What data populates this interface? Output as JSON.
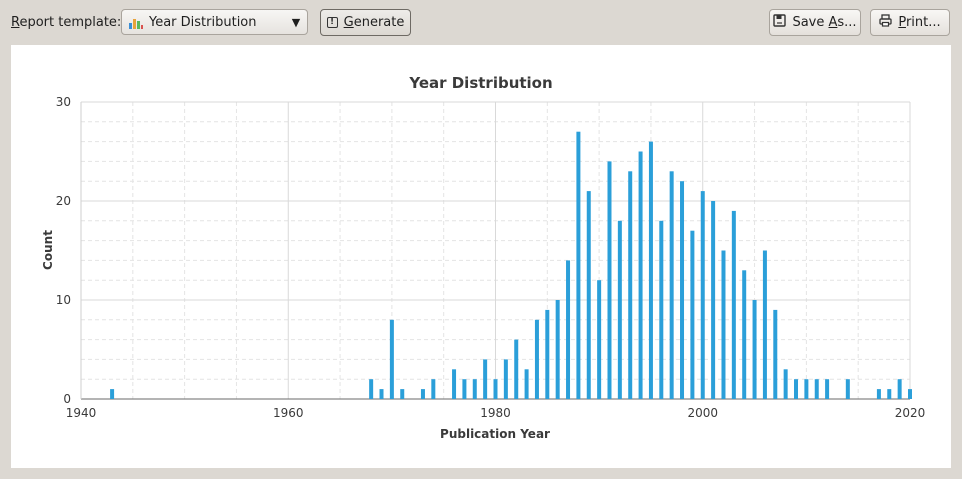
{
  "toolbar": {
    "template_label_mnemonic": "R",
    "template_label_rest": "eport template:",
    "template_value": "Year Distribution",
    "template_icon": "bar-chart-icon",
    "generate_mnemonic": "G",
    "generate_rest": "enerate",
    "generate_icon": "generate-icon",
    "save_pre": "Save ",
    "save_mnemonic": "A",
    "save_post": "s...",
    "save_icon": "save-icon",
    "print_pre": "",
    "print_mnemonic": "P",
    "print_post": "rint...",
    "print_icon": "printer-icon"
  },
  "chart_data": {
    "type": "bar",
    "title": "Year Distribution",
    "xlabel": "Publication Year",
    "ylabel": "Count",
    "xlim": [
      1940,
      2020
    ],
    "ylim": [
      0,
      30
    ],
    "x_ticks": [
      "1940",
      "1960",
      "1980",
      "2000",
      "2020"
    ],
    "y_ticks": [
      "0",
      "10",
      "20",
      "30"
    ],
    "grid": true,
    "bar_color": "#2b9fd9",
    "x": [
      1943,
      1968,
      1969,
      1970,
      1971,
      1973,
      1974,
      1976,
      1977,
      1978,
      1979,
      1980,
      1981,
      1982,
      1983,
      1984,
      1985,
      1986,
      1987,
      1988,
      1989,
      1990,
      1991,
      1992,
      1993,
      1994,
      1995,
      1996,
      1997,
      1998,
      1999,
      2000,
      2001,
      2002,
      2003,
      2004,
      2005,
      2006,
      2007,
      2008,
      2009,
      2010,
      2011,
      2012,
      2014,
      2017,
      2018,
      2019,
      2020
    ],
    "values": [
      1,
      2,
      1,
      8,
      1,
      1,
      2,
      3,
      2,
      2,
      4,
      2,
      4,
      6,
      3,
      8,
      9,
      10,
      14,
      27,
      21,
      12,
      24,
      18,
      23,
      25,
      26,
      18,
      23,
      22,
      17,
      21,
      20,
      15,
      19,
      13,
      10,
      15,
      9,
      3,
      2,
      2,
      2,
      2,
      2,
      1,
      1,
      2,
      1
    ]
  }
}
